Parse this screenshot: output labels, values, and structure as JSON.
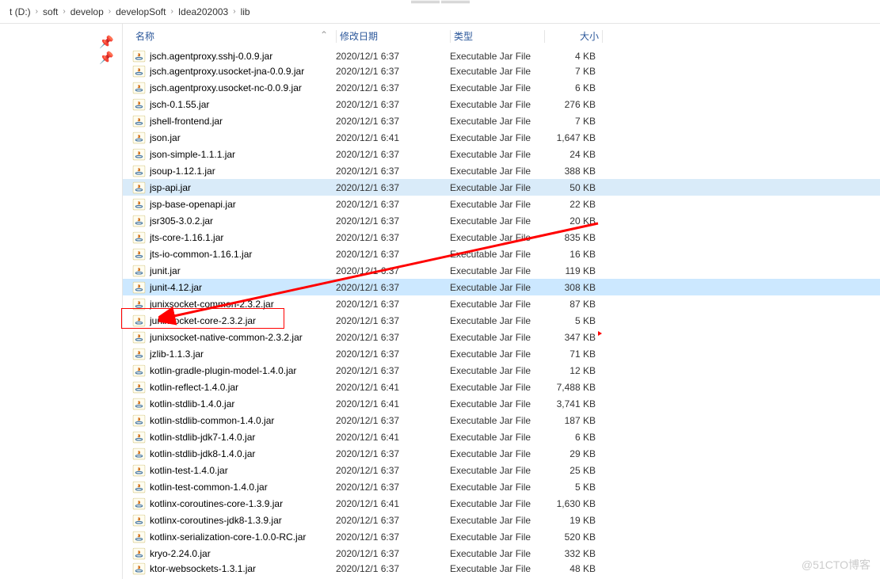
{
  "breadcrumb": [
    "t (D:)",
    "soft",
    "develop",
    "developSoft",
    "Idea202003",
    "lib"
  ],
  "columns": {
    "name": "名称",
    "date": "修改日期",
    "type": "类型",
    "size": "大小"
  },
  "watermark": "@51CTO博客",
  "files": [
    {
      "name": "jsch.agentproxy.sshj-0.0.9.jar",
      "date": "2020/12/1 6:37",
      "type": "Executable Jar File",
      "size": "4 KB",
      "half": true
    },
    {
      "name": "jsch.agentproxy.usocket-jna-0.0.9.jar",
      "date": "2020/12/1 6:37",
      "type": "Executable Jar File",
      "size": "7 KB"
    },
    {
      "name": "jsch.agentproxy.usocket-nc-0.0.9.jar",
      "date": "2020/12/1 6:37",
      "type": "Executable Jar File",
      "size": "6 KB"
    },
    {
      "name": "jsch-0.1.55.jar",
      "date": "2020/12/1 6:37",
      "type": "Executable Jar File",
      "size": "276 KB"
    },
    {
      "name": "jshell-frontend.jar",
      "date": "2020/12/1 6:37",
      "type": "Executable Jar File",
      "size": "7 KB"
    },
    {
      "name": "json.jar",
      "date": "2020/12/1 6:41",
      "type": "Executable Jar File",
      "size": "1,647 KB"
    },
    {
      "name": "json-simple-1.1.1.jar",
      "date": "2020/12/1 6:37",
      "type": "Executable Jar File",
      "size": "24 KB"
    },
    {
      "name": "jsoup-1.12.1.jar",
      "date": "2020/12/1 6:37",
      "type": "Executable Jar File",
      "size": "388 KB"
    },
    {
      "name": "jsp-api.jar",
      "date": "2020/12/1 6:37",
      "type": "Executable Jar File",
      "size": "50 KB",
      "hl": 1
    },
    {
      "name": "jsp-base-openapi.jar",
      "date": "2020/12/1 6:37",
      "type": "Executable Jar File",
      "size": "22 KB"
    },
    {
      "name": "jsr305-3.0.2.jar",
      "date": "2020/12/1 6:37",
      "type": "Executable Jar File",
      "size": "20 KB"
    },
    {
      "name": "jts-core-1.16.1.jar",
      "date": "2020/12/1 6:37",
      "type": "Executable Jar File",
      "size": "835 KB"
    },
    {
      "name": "jts-io-common-1.16.1.jar",
      "date": "2020/12/1 6:37",
      "type": "Executable Jar File",
      "size": "16 KB"
    },
    {
      "name": "junit.jar",
      "date": "2020/12/1 6:37",
      "type": "Executable Jar File",
      "size": "119 KB"
    },
    {
      "name": "junit-4.12.jar",
      "date": "2020/12/1 6:37",
      "type": "Executable Jar File",
      "size": "308 KB",
      "hl": 2
    },
    {
      "name": "junixsocket-common-2.3.2.jar",
      "date": "2020/12/1 6:37",
      "type": "Executable Jar File",
      "size": "87 KB"
    },
    {
      "name": "junixsocket-core-2.3.2.jar",
      "date": "2020/12/1 6:37",
      "type": "Executable Jar File",
      "size": "5 KB"
    },
    {
      "name": "junixsocket-native-common-2.3.2.jar",
      "date": "2020/12/1 6:37",
      "type": "Executable Jar File",
      "size": "347 KB"
    },
    {
      "name": "jzlib-1.1.3.jar",
      "date": "2020/12/1 6:37",
      "type": "Executable Jar File",
      "size": "71 KB"
    },
    {
      "name": "kotlin-gradle-plugin-model-1.4.0.jar",
      "date": "2020/12/1 6:37",
      "type": "Executable Jar File",
      "size": "12 KB"
    },
    {
      "name": "kotlin-reflect-1.4.0.jar",
      "date": "2020/12/1 6:41",
      "type": "Executable Jar File",
      "size": "7,488 KB"
    },
    {
      "name": "kotlin-stdlib-1.4.0.jar",
      "date": "2020/12/1 6:41",
      "type": "Executable Jar File",
      "size": "3,741 KB"
    },
    {
      "name": "kotlin-stdlib-common-1.4.0.jar",
      "date": "2020/12/1 6:37",
      "type": "Executable Jar File",
      "size": "187 KB"
    },
    {
      "name": "kotlin-stdlib-jdk7-1.4.0.jar",
      "date": "2020/12/1 6:41",
      "type": "Executable Jar File",
      "size": "6 KB"
    },
    {
      "name": "kotlin-stdlib-jdk8-1.4.0.jar",
      "date": "2020/12/1 6:37",
      "type": "Executable Jar File",
      "size": "29 KB"
    },
    {
      "name": "kotlin-test-1.4.0.jar",
      "date": "2020/12/1 6:37",
      "type": "Executable Jar File",
      "size": "25 KB"
    },
    {
      "name": "kotlin-test-common-1.4.0.jar",
      "date": "2020/12/1 6:37",
      "type": "Executable Jar File",
      "size": "5 KB"
    },
    {
      "name": "kotlinx-coroutines-core-1.3.9.jar",
      "date": "2020/12/1 6:41",
      "type": "Executable Jar File",
      "size": "1,630 KB"
    },
    {
      "name": "kotlinx-coroutines-jdk8-1.3.9.jar",
      "date": "2020/12/1 6:37",
      "type": "Executable Jar File",
      "size": "19 KB"
    },
    {
      "name": "kotlinx-serialization-core-1.0.0-RC.jar",
      "date": "2020/12/1 6:37",
      "type": "Executable Jar File",
      "size": "520 KB"
    },
    {
      "name": "kryo-2.24.0.jar",
      "date": "2020/12/1 6:37",
      "type": "Executable Jar File",
      "size": "332 KB"
    },
    {
      "name": "ktor-websockets-1.3.1.jar",
      "date": "2020/12/1 6:37",
      "type": "Executable Jar File",
      "size": "48 KB",
      "half": true
    }
  ]
}
